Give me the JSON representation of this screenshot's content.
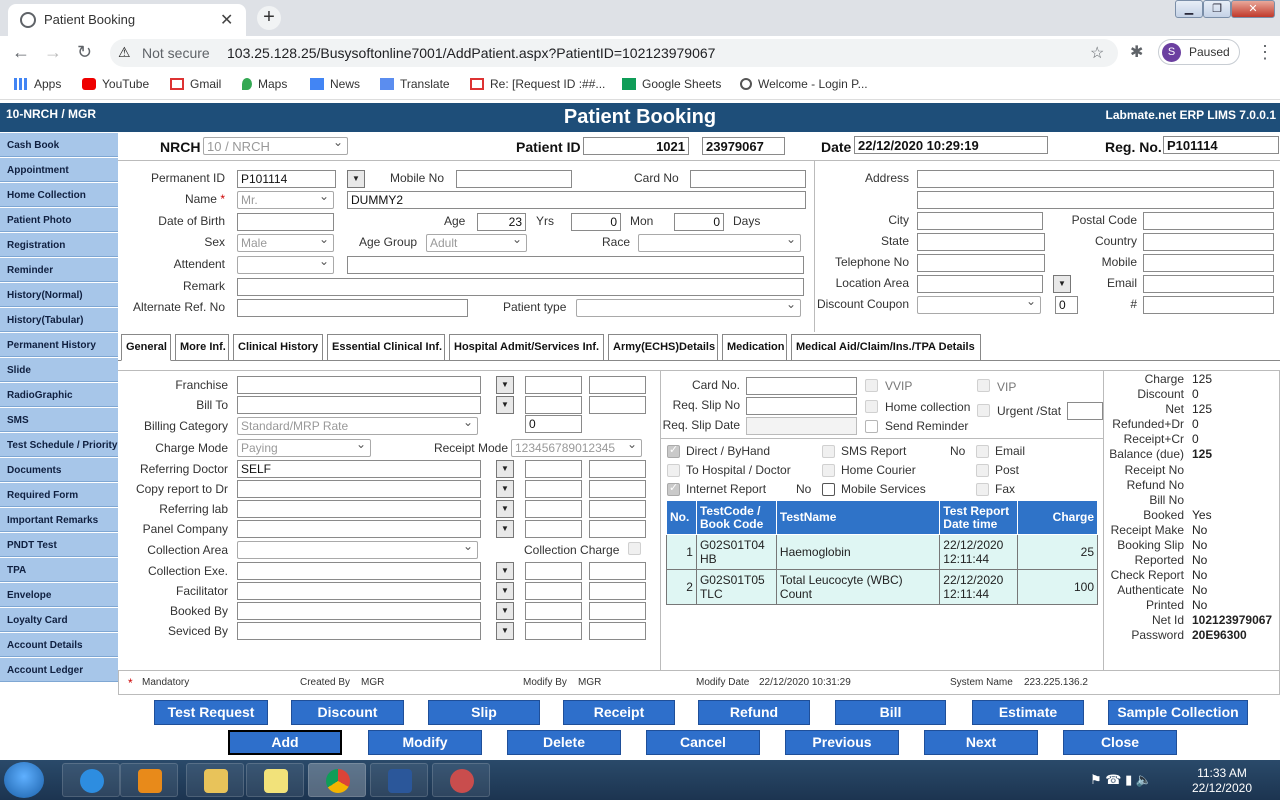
{
  "browser": {
    "tab_title": "Patient Booking",
    "not_secure": "Not secure",
    "url": "103.25.128.25/Busysoftonline7001/AddPatient.aspx?PatientID=102123979067",
    "profile_initial": "S",
    "profile_status": "Paused",
    "bookmarks": [
      "Apps",
      "YouTube",
      "Gmail",
      "Maps",
      "News",
      "Translate",
      "Re: [Request ID :##...",
      "Google Sheets",
      "Welcome - Login P..."
    ]
  },
  "app": {
    "user": "10-NRCH / MGR",
    "title": "Patient Booking",
    "version": "Labmate.net ERP LIMS 7.0.0.1"
  },
  "sidebar": [
    "Cash Book",
    "Appointment",
    "Home Collection",
    "Patient Photo",
    "Registration",
    "Reminder",
    "History(Normal)",
    "History(Tabular)",
    "Permanent History",
    "Slide",
    "RadioGraphic",
    "SMS",
    "Test Schedule / Priority",
    "Documents",
    "Required Form",
    "Important Remarks",
    "PNDT Test",
    "TPA",
    "Envelope",
    "Loyalty Card",
    "Account Details",
    "Account Ledger"
  ],
  "header": {
    "nrch_label": "NRCH",
    "nrch_value": "10 / NRCH",
    "patient_id_label": "Patient ID",
    "patient_id_a": "1021",
    "patient_id_b": "23979067",
    "date_label": "Date",
    "date_value": "22/12/2020 10:29:19",
    "regno_label": "Reg. No.",
    "regno_value": "P101114"
  },
  "patient": {
    "permanent_id_label": "Permanent ID",
    "permanent_id": "P101114",
    "mobile_label": "Mobile No",
    "card_label": "Card No",
    "name_label": "Name",
    "mandatory_star": "*",
    "title": "Mr.",
    "name": "DUMMY2",
    "dob_label": "Date of Birth",
    "age_label": "Age",
    "age": "23",
    "yrs": "Yrs",
    "mon_val": "0",
    "mon": "Mon",
    "days_val": "0",
    "days": "Days",
    "sex_label": "Sex",
    "sex": "Male",
    "age_group_label": "Age Group",
    "age_group": "Adult",
    "race_label": "Race",
    "attendent_label": "Attendent",
    "remark_label": "Remark",
    "alt_ref_label": "Alternate Ref. No",
    "patient_type_label": "Patient type"
  },
  "address": {
    "address_label": "Address",
    "city_label": "City",
    "postal_label": "Postal Code",
    "state_label": "State",
    "country_label": "Country",
    "telephone_label": "Telephone No",
    "mobile_label": "Mobile",
    "location_label": "Location Area",
    "email_label": "Email",
    "discount_label": "Discount Coupon",
    "discount_val": "0",
    "hash": "#"
  },
  "tabs": [
    "General",
    "More Inf.",
    "Clinical History",
    "Essential Clinical Inf.",
    "Hospital Admit/Services Inf.",
    "Army(ECHS)Details",
    "Medication",
    "Medical Aid/Claim/Ins./TPA Details"
  ],
  "general": {
    "franchise": "Franchise",
    "bill_to": "Bill To",
    "billing_category": "Billing Category",
    "billing_category_val": "Standard/MRP Rate",
    "billing_num": "0",
    "charge_mode": "Charge Mode",
    "charge_mode_val": "Paying",
    "receipt_mode": "Receipt Mode",
    "receipt_mode_val": "123456789012345",
    "referring_doctor": "Referring Doctor",
    "referring_doctor_val": "SELF",
    "copy_report": "Copy report to Dr",
    "referring_lab": "Referring lab",
    "panel_company": "Panel Company",
    "collection_area": "Collection Area",
    "collection_charge": "Collection Charge",
    "collection_exe": "Collection Exe.",
    "facilitator": "Facilitator",
    "booked_by": "Booked By",
    "serviced_by": "Seviced By"
  },
  "mid": {
    "card_no": "Card No.",
    "vvip": "VVIP",
    "vip": "VIP",
    "req_slip_no": "Req. Slip No",
    "home_collection": "Home collection",
    "urgent": "Urgent /Stat",
    "req_slip_date": "Req. Slip Date",
    "send_reminder": "Send Reminder",
    "direct": "Direct / ByHand",
    "sms_report": "SMS Report",
    "no1": "No",
    "email": "Email",
    "to_hospital": "To Hospital / Doctor",
    "home_courier": "Home Courier",
    "post": "Post",
    "internet_report": "Internet Report",
    "no2": "No",
    "mobile_services": "Mobile Services",
    "fax": "Fax"
  },
  "tests": {
    "headers": [
      "No.",
      "TestCode / Book Code",
      "TestName",
      "Test Report Date time",
      "Charge"
    ],
    "rows": [
      {
        "no": "1",
        "code": "G02S01T04 HB",
        "name": "Haemoglobin",
        "date": "22/12/2020 12:11:44",
        "charge": "25"
      },
      {
        "no": "2",
        "code": "G02S01T05 TLC",
        "name": "Total Leucocyte (WBC) Count",
        "date": "22/12/2020 12:11:44",
        "charge": "100"
      }
    ]
  },
  "summary": [
    [
      "Charge",
      "125"
    ],
    [
      "Discount",
      "0"
    ],
    [
      "Net",
      "125"
    ],
    [
      "Refunded+Dr",
      "0"
    ],
    [
      "Receipt+Cr",
      "0"
    ],
    [
      "Balance (due)",
      "125"
    ],
    [
      "Receipt No",
      ""
    ],
    [
      "Refund No",
      ""
    ],
    [
      "Bill No",
      ""
    ],
    [
      "Booked",
      "Yes"
    ],
    [
      "Receipt Make",
      "No"
    ],
    [
      "Booking Slip",
      "No"
    ],
    [
      "Reported",
      "No"
    ],
    [
      "Check Report",
      "No"
    ],
    [
      "Authenticate",
      "No"
    ],
    [
      "Printed",
      "No"
    ],
    [
      "Net Id",
      "102123979067"
    ],
    [
      "Password",
      "20E96300"
    ]
  ],
  "footer": {
    "mandatory": "Mandatory",
    "star": "*",
    "created_by_label": "Created By",
    "created_by": "MGR",
    "modify_by_label": "Modify By",
    "modify_by": "MGR",
    "modify_date_label": "Modify Date",
    "modify_date": "22/12/2020 10:31:29",
    "system_name_label": "System Name",
    "system_name": "223.225.136.2"
  },
  "buttons_row1": [
    "Test Request",
    "Discount",
    "Slip",
    "Receipt",
    "Refund",
    "Bill",
    "Estimate",
    "Sample Collection"
  ],
  "buttons_row2": [
    "Add",
    "Modify",
    "Delete",
    "Cancel",
    "Previous",
    "Next",
    "Close"
  ],
  "taskbar": {
    "time": "11:33 AM",
    "date": "22/12/2020"
  }
}
